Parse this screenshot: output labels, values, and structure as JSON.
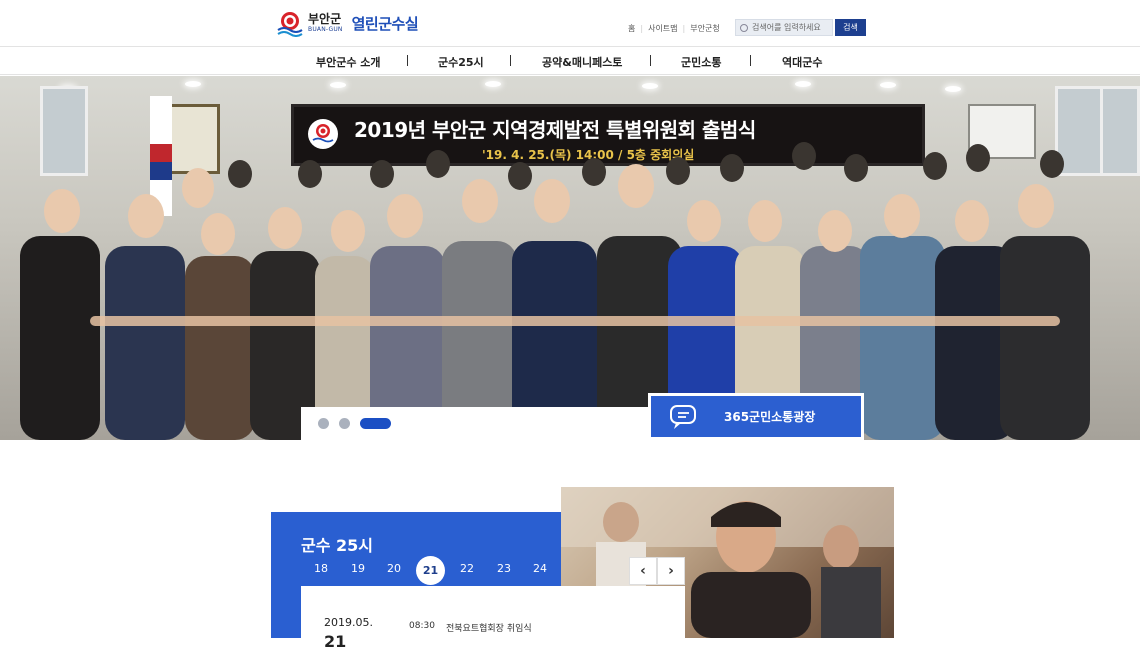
{
  "header": {
    "logo_ko": "부안군",
    "logo_en": "BUAN-GUN",
    "site_title": "열린군수실",
    "util_links": [
      "홈",
      "사이트맵",
      "부안군청"
    ],
    "search_placeholder": "검색어를 입력하세요",
    "search_button": "검색"
  },
  "nav": {
    "items": [
      "부안군수 소개",
      "군수25시",
      "공약&매니페스토",
      "군민소통",
      "역대군수"
    ]
  },
  "hero": {
    "banner_title": "2019년 부안군 지역경제발전 특별위원회 출범식",
    "banner_sub": "'19. 4. 25.(목) 14:00  /  5층 중회의실",
    "square_label": "365군민소통광장",
    "slide_count": 3,
    "active_slide": 3
  },
  "gunsu": {
    "title": "군수 25시",
    "days": [
      "18",
      "19",
      "20",
      "21",
      "22",
      "23",
      "24"
    ],
    "active_day": "21",
    "prev_label": "‹",
    "next_label": "›",
    "schedule_date": "2019.05.",
    "schedule_day": "21",
    "schedule_time": "08:30",
    "schedule_text": "전북요트협회장 취임식"
  },
  "colors": {
    "accent": "#2a5fd1",
    "navy": "#1d3f8f"
  }
}
